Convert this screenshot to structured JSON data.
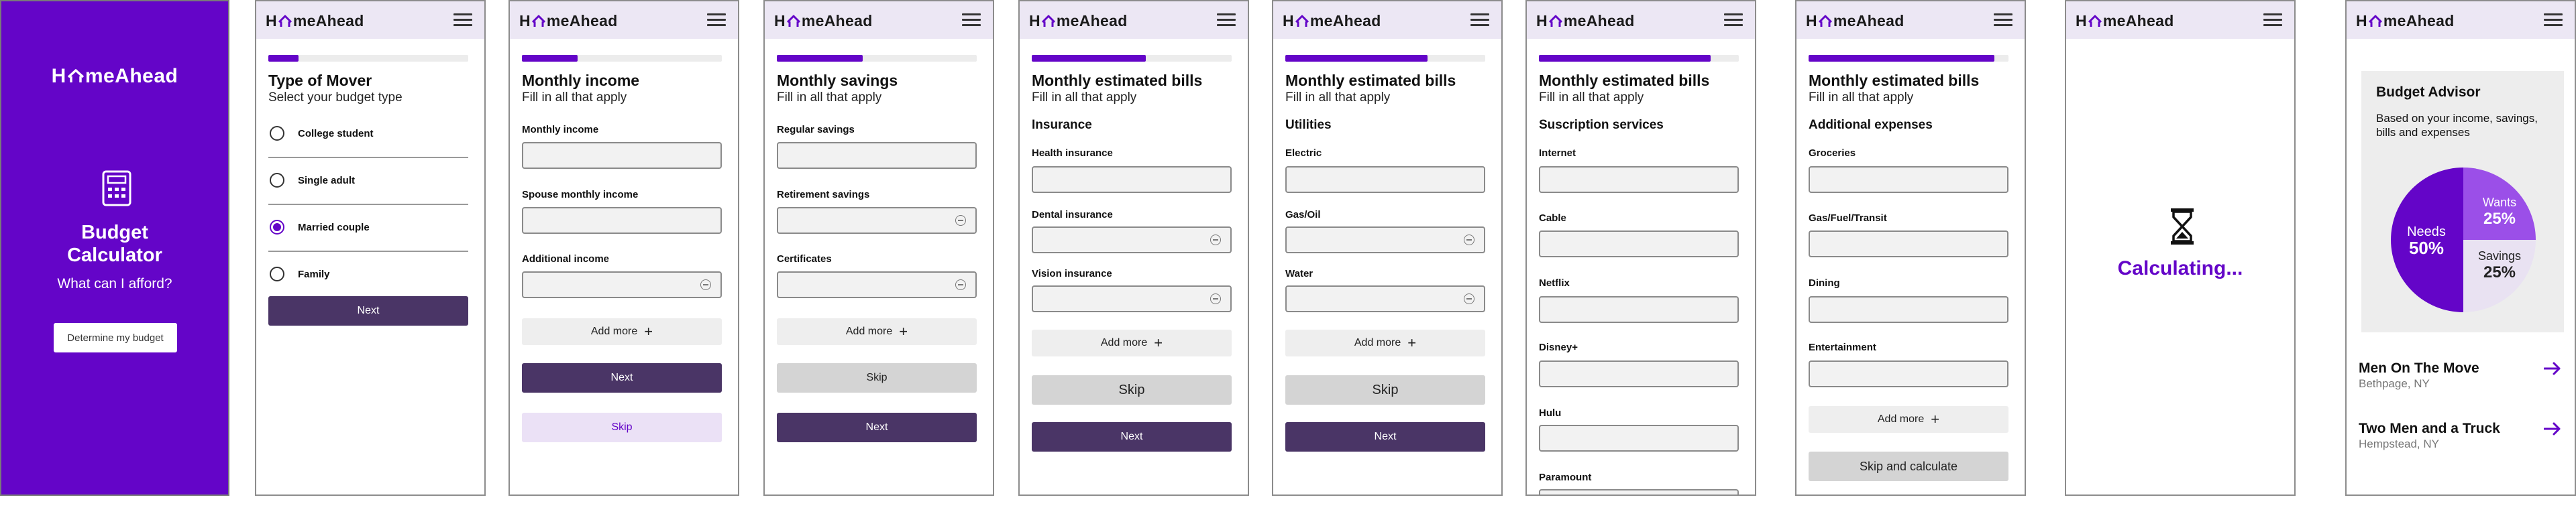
{
  "brand": {
    "name_left": "H",
    "name_right": "meAhead",
    "accent": "#6405c8",
    "dark_button": "#4a3566",
    "header_bg": "#ece7f4"
  },
  "icons": {
    "menu": "hamburger-icon",
    "calculator": "calculator-icon",
    "hourglass": "hourglass-icon",
    "plus": "plus-icon",
    "minus": "minus-circle-icon",
    "arrow": "arrow-right-icon"
  },
  "splash": {
    "title": "Budget Calculator",
    "tagline": "What can I afford?",
    "cta": "Determine my budget"
  },
  "mover_type": {
    "progress": 0.15,
    "title": "Type of Mover",
    "subtitle": "Select your budget type",
    "options": [
      {
        "label": "College student",
        "selected": false
      },
      {
        "label": "Single adult",
        "selected": false
      },
      {
        "label": "Married couple",
        "selected": true
      },
      {
        "label": "Family",
        "selected": false
      }
    ],
    "next": "Next"
  },
  "income": {
    "progress": 0.28,
    "title": "Monthly income",
    "subtitle": "Fill in all that apply",
    "fields": [
      "Monthly income",
      "Spouse monthly income",
      "Additional income"
    ],
    "add_more": "Add more",
    "next": "Next",
    "skip": "Skip"
  },
  "savings": {
    "progress": 0.43,
    "title": "Monthly savings",
    "subtitle": "Fill in all that apply",
    "fields": [
      "Regular savings",
      "Retirement savings",
      "Certificates"
    ],
    "add_more": "Add more",
    "skip": "Skip",
    "next": "Next"
  },
  "insurance": {
    "progress": 0.57,
    "title": "Monthly estimated bills",
    "subtitle": "Fill in all that apply",
    "section": "Insurance",
    "fields": [
      "Health insurance",
      "Dental insurance",
      "Vision insurance"
    ],
    "add_more": "Add more",
    "skip": "Skip",
    "next": "Next"
  },
  "utilities": {
    "progress": 0.71,
    "title": "Monthly estimated bills",
    "subtitle": "Fill in all that apply",
    "section": "Utilities",
    "fields": [
      "Electric",
      "Gas/Oil",
      "Water"
    ],
    "add_more": "Add more",
    "skip": "Skip",
    "next": "Next"
  },
  "subscriptions": {
    "progress": 0.86,
    "title": "Monthly estimated bills",
    "subtitle": "Fill in all that apply",
    "section": "Suscription services",
    "fields": [
      "Internet",
      "Cable",
      "Netflix",
      "Disney+",
      "Hulu",
      "Paramount"
    ]
  },
  "additional": {
    "progress": 0.93,
    "title": "Monthly estimated bills",
    "subtitle": "Fill in all that apply",
    "section": "Additional expenses",
    "fields": [
      "Groceries",
      "Gas/Fuel/Transit",
      "Dining",
      "Entertainment"
    ],
    "add_more": "Add more",
    "skip_calc": "Skip and calculate"
  },
  "calculating": {
    "text": "Calculating..."
  },
  "advisor": {
    "title": "Budget Advisor",
    "subtitle": "Based on your income, savings, bills and expenses",
    "slices": [
      {
        "label": "Needs",
        "pct": "50%",
        "value": 50,
        "color": "#6405c8"
      },
      {
        "label": "Wants",
        "pct": "25%",
        "value": 25,
        "color": "#9b4fe8"
      },
      {
        "label": "Savings",
        "pct": "25%",
        "value": 25,
        "color": "#e9e2f2"
      }
    ],
    "movers": [
      {
        "name": "Men On The Move",
        "location": "Bethpage, NY"
      },
      {
        "name": "Two Men and a Truck",
        "location": "Hempstead, NY"
      }
    ]
  }
}
